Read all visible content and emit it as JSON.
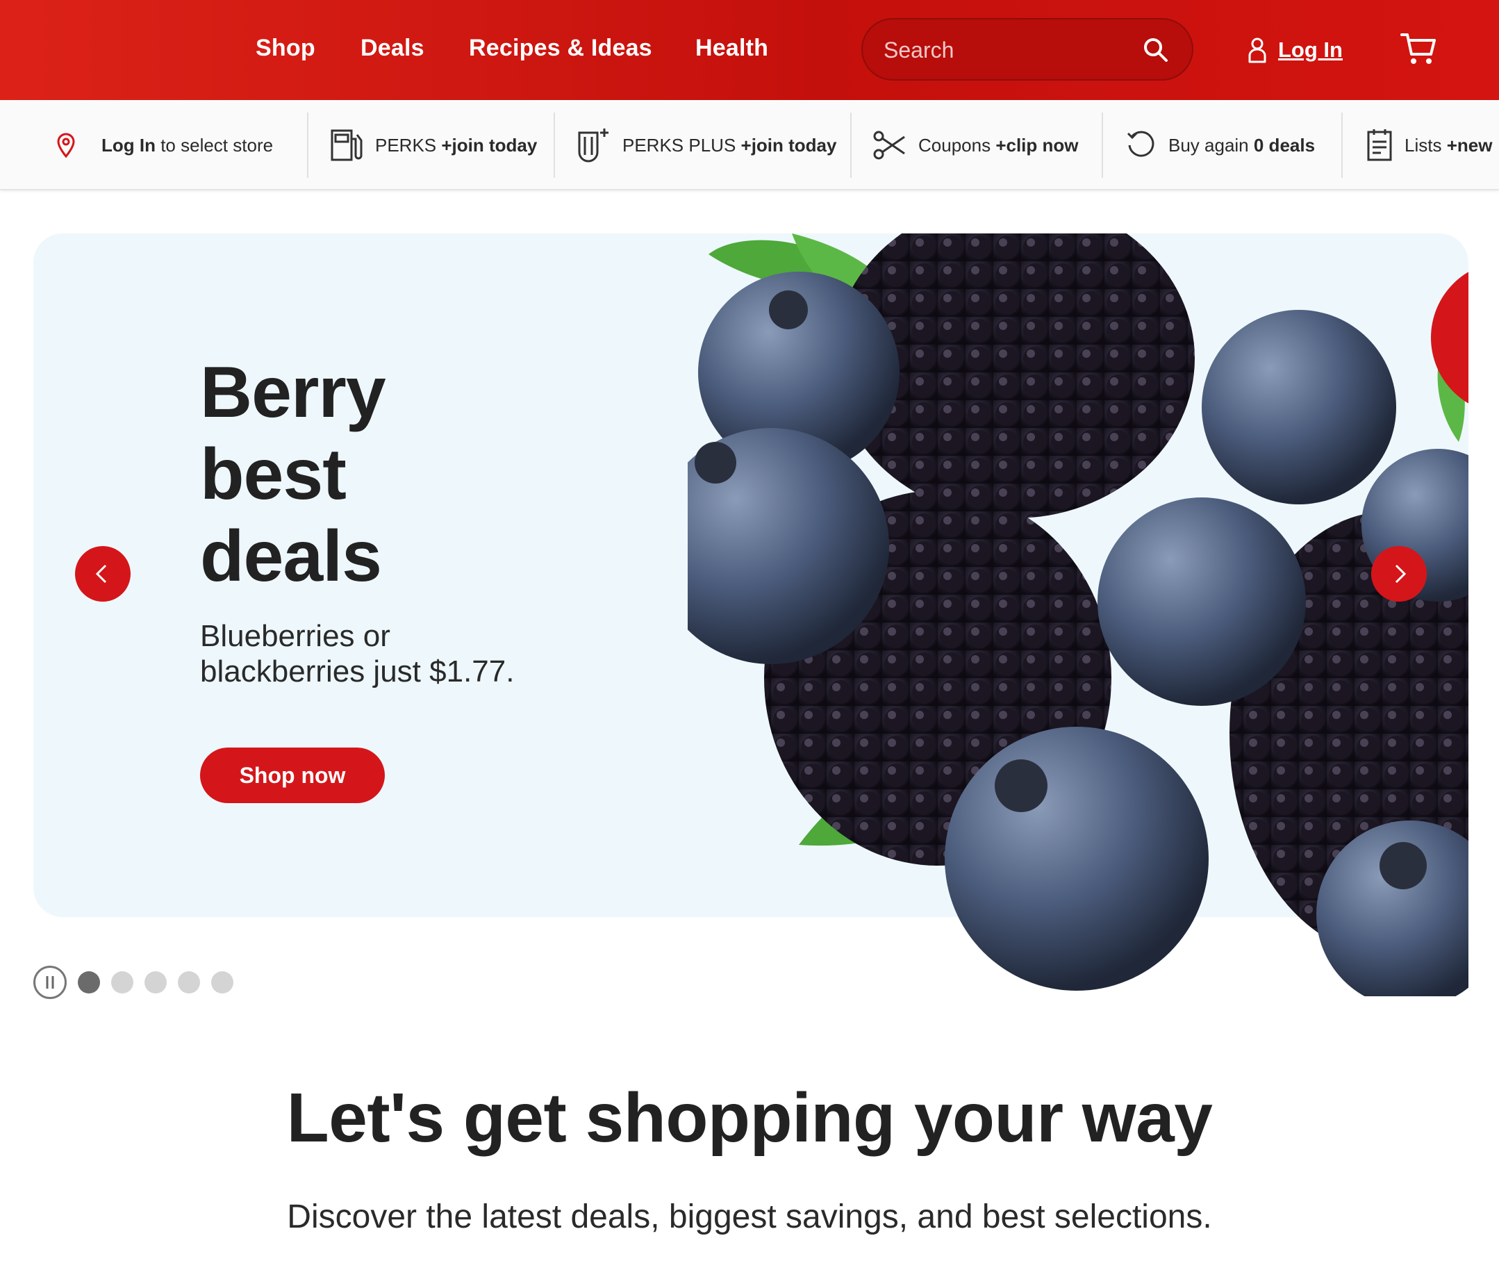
{
  "header": {
    "nav": [
      "Shop",
      "Deals",
      "Recipes & Ideas",
      "Health"
    ],
    "search_placeholder": "Search",
    "login_label": "Log In"
  },
  "subbar": {
    "store": {
      "bold": "Log In",
      "text": " to select store"
    },
    "perks": {
      "text": "PERKS ",
      "bold": "+join today"
    },
    "perks_plus": {
      "text": "PERKS PLUS ",
      "bold": "+join today"
    },
    "coupons": {
      "text": "Coupons ",
      "bold": "+clip now"
    },
    "buy_again": {
      "text": "Buy again ",
      "bold": "0 deals"
    },
    "lists": {
      "text": "Lists ",
      "bold": "+new"
    }
  },
  "hero": {
    "title_lines": [
      "Berry",
      "best",
      "deals"
    ],
    "subtitle": "Blueberries or blackberries just $1.77.",
    "cta": "Shop now",
    "slides_total": 5,
    "active_slide": 1
  },
  "section": {
    "title": "Let's get shopping your way",
    "subtitle": "Discover the latest deals, biggest savings, and best selections."
  },
  "colors": {
    "brand_red": "#d4161a",
    "hero_bg": "#eef8fc"
  }
}
